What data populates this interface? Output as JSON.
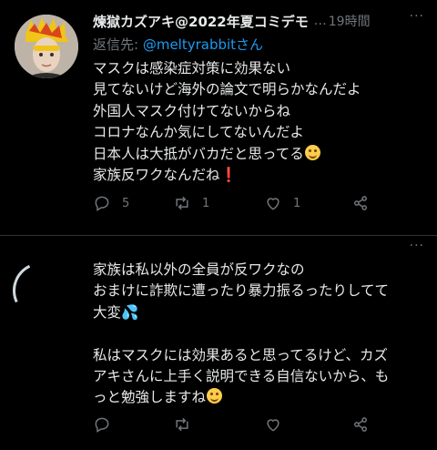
{
  "tweet1": {
    "display_name": "煉獄カズアキ@2022年夏コミデモ",
    "separator": "…",
    "time": "19時間",
    "more": "···",
    "reply_prefix": "返信先: ",
    "reply_handle": "@meltyrabbitさん",
    "lines": [
      "マスクは感染症対策に効果ない",
      "見てないけど海外の論文で明らかなんだよ",
      "外国人マスク付けてないからね",
      "コロナなんか気にしてないんだよ",
      "日本人は大抵がバカだと思ってる",
      "家族反ワクなんだね"
    ],
    "exclaim": "❗",
    "counts": {
      "reply": "5",
      "retweet": "1",
      "like": "1"
    }
  },
  "tweet2": {
    "more": "···",
    "lines": [
      "家族は私以外の全員が反ワクなの",
      "おまけに詐欺に遭ったり暴力振るったりしてて",
      "大変💦",
      "",
      "私はマスクには効果あると思ってるけど、カズ",
      "アキさんに上手く説明できる自信ないから、も",
      "っと勉強しますね"
    ]
  },
  "colors": {
    "background": "#000000",
    "text": "#e7e9ea",
    "muted": "#71767b",
    "accent": "#1d9bf0"
  },
  "icons": [
    "reply-icon",
    "retweet-icon",
    "like-icon",
    "share-icon",
    "more-icon",
    "smile-emoji-icon"
  ]
}
